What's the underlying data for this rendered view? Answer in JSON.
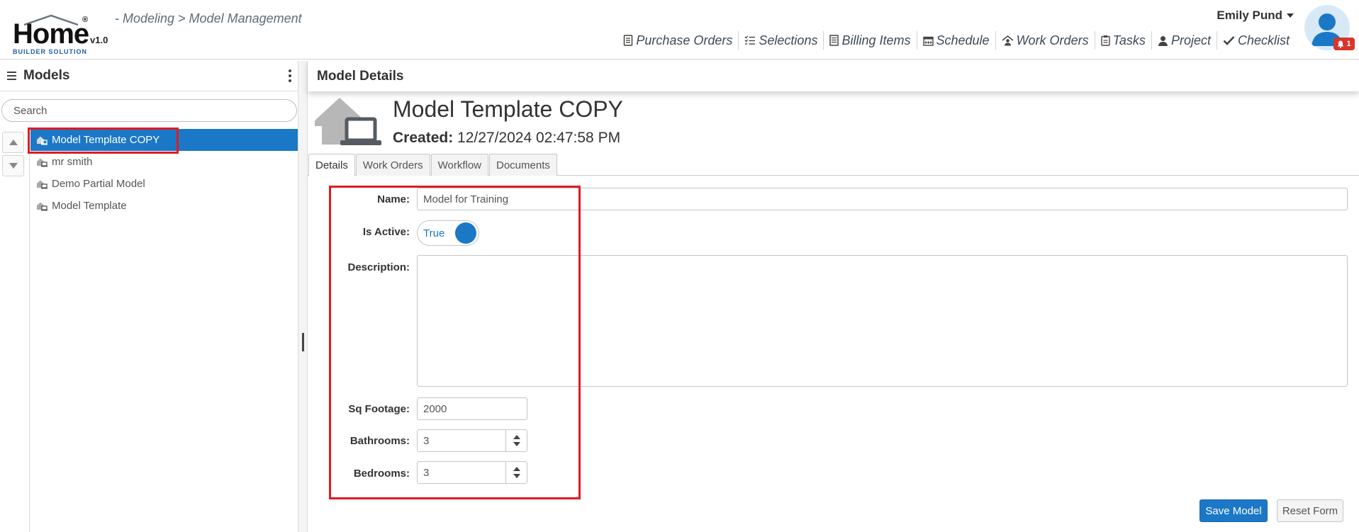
{
  "header": {
    "logo_text": "Home",
    "logo_reg": "®",
    "logo_sub": "BUILDER SOLUTION",
    "version": "v1.0",
    "breadcrumb": "- Modeling > Model Management",
    "user_name": "Emily Pund",
    "notification_count": "1",
    "nav": [
      {
        "label": "Purchase Orders",
        "icon": "document-icon"
      },
      {
        "label": "Selections",
        "icon": "checklist-icon"
      },
      {
        "label": "Billing Items",
        "icon": "ledger-icon"
      },
      {
        "label": "Schedule",
        "icon": "calendar-icon"
      },
      {
        "label": "Work Orders",
        "icon": "house-worker-icon"
      },
      {
        "label": "Tasks",
        "icon": "clipboard-icon"
      },
      {
        "label": "Project",
        "icon": "person-icon"
      },
      {
        "label": "Checklist",
        "icon": "checkmark-icon"
      }
    ]
  },
  "left_panel": {
    "title": "Models",
    "search_placeholder": "Search",
    "items": [
      {
        "label": "Model Template COPY",
        "selected": true
      },
      {
        "label": "mr smith",
        "selected": false
      },
      {
        "label": "Demo Partial Model",
        "selected": false
      },
      {
        "label": "Model Template",
        "selected": false
      }
    ]
  },
  "right_panel": {
    "title": "Model Details",
    "model_name": "Model Template COPY",
    "created_label": "Created:",
    "created_value": "12/27/2024 02:47:58 PM",
    "tabs": [
      {
        "label": "Details",
        "active": true
      },
      {
        "label": "Work Orders",
        "active": false
      },
      {
        "label": "Workflow",
        "active": false
      },
      {
        "label": "Documents",
        "active": false
      }
    ],
    "form": {
      "name_label": "Name:",
      "name_value": "Model for Training",
      "active_label": "Is Active:",
      "active_value": "True",
      "description_label": "Description:",
      "description_value": "",
      "sqft_label": "Sq Footage:",
      "sqft_value": "2000",
      "bathrooms_label": "Bathrooms:",
      "bathrooms_value": "3",
      "bedrooms_label": "Bedrooms:",
      "bedrooms_value": "3"
    },
    "save_label": "Save Model",
    "reset_label": "Reset Form"
  },
  "colors": {
    "accent": "#1b78c6",
    "highlight_outline": "#e01b24",
    "badge": "#d9352a"
  }
}
